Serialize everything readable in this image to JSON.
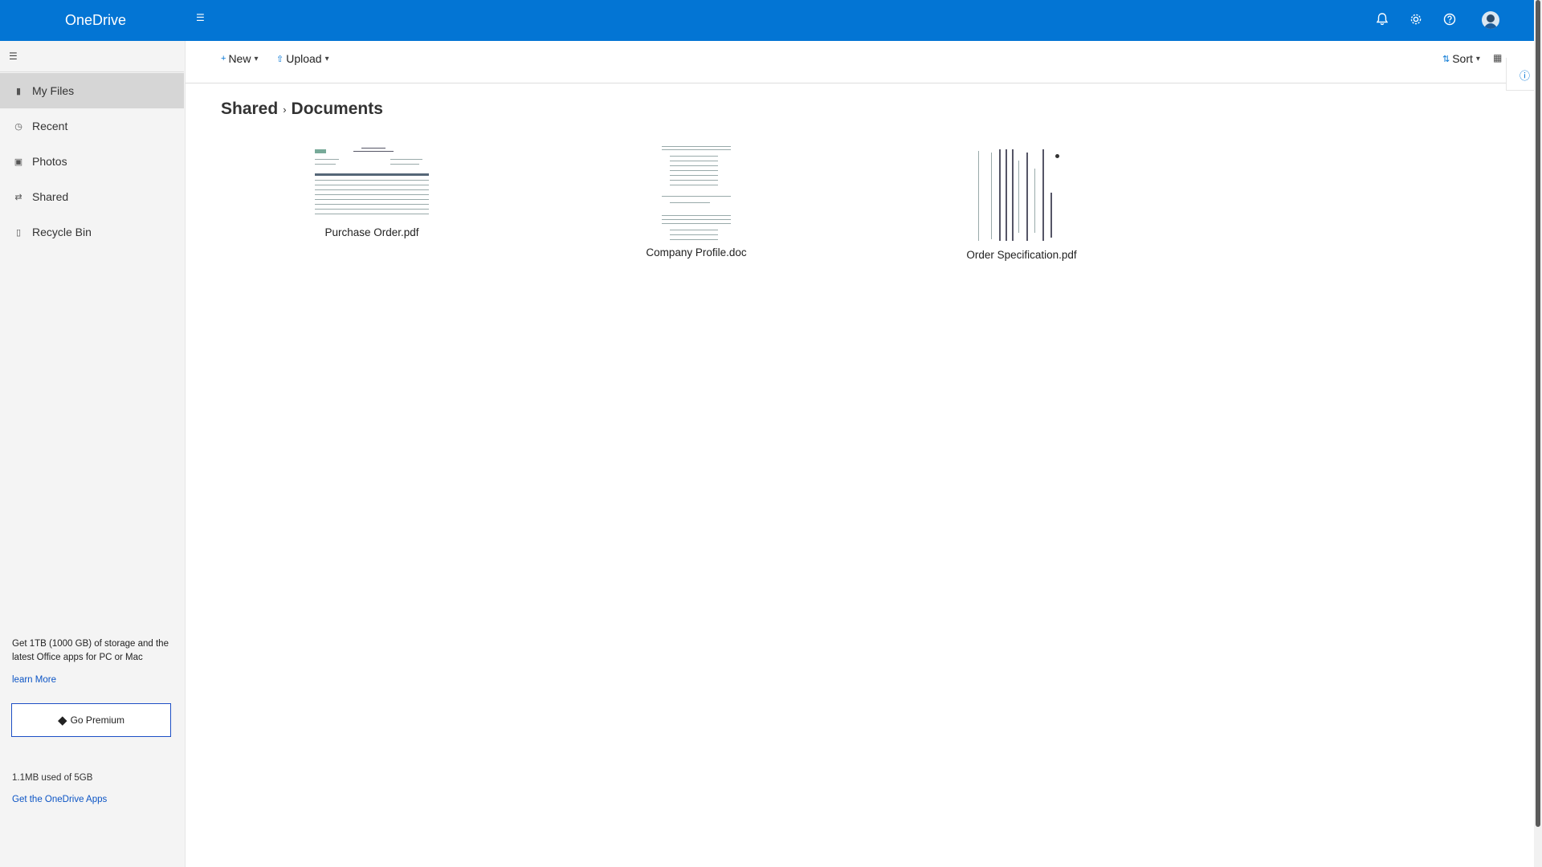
{
  "header": {
    "app_name": "OneDrive",
    "icons": [
      "hamburger-icon",
      "bell-icon",
      "gear-icon",
      "help-icon",
      "avatar"
    ]
  },
  "sidebar": {
    "items": [
      {
        "label": "My Files",
        "icon": "folder-icon",
        "active": true
      },
      {
        "label": "Recent",
        "icon": "clock-icon",
        "active": false
      },
      {
        "label": "Photos",
        "icon": "image-icon",
        "active": false
      },
      {
        "label": "Shared",
        "icon": "share-icon",
        "active": false
      },
      {
        "label": "Recycle Bin",
        "icon": "trash-icon",
        "active": false
      }
    ],
    "promo_text": "Get 1TB (1000 GB) of storage and the latest Office apps for PC or Mac",
    "learn_more": "learn More",
    "premium_label": "Go Premium",
    "storage_text": "1.1MB used of 5GB",
    "apps_link": "Get the OneDrive Apps"
  },
  "commandbar": {
    "new_label": "New",
    "upload_label": "Upload",
    "sort_label": "Sort"
  },
  "breadcrumb": {
    "parent": "Shared",
    "current": "Documents"
  },
  "files": [
    {
      "name": "Purchase Order.pdf"
    },
    {
      "name": "Company Profile.doc"
    },
    {
      "name": "Order Specification.pdf"
    }
  ],
  "colors": {
    "accent": "#0375d4",
    "sidebar_bg": "#f4f4f4",
    "active_item_bg": "#d6d6d6",
    "link": "#0b54c5"
  }
}
